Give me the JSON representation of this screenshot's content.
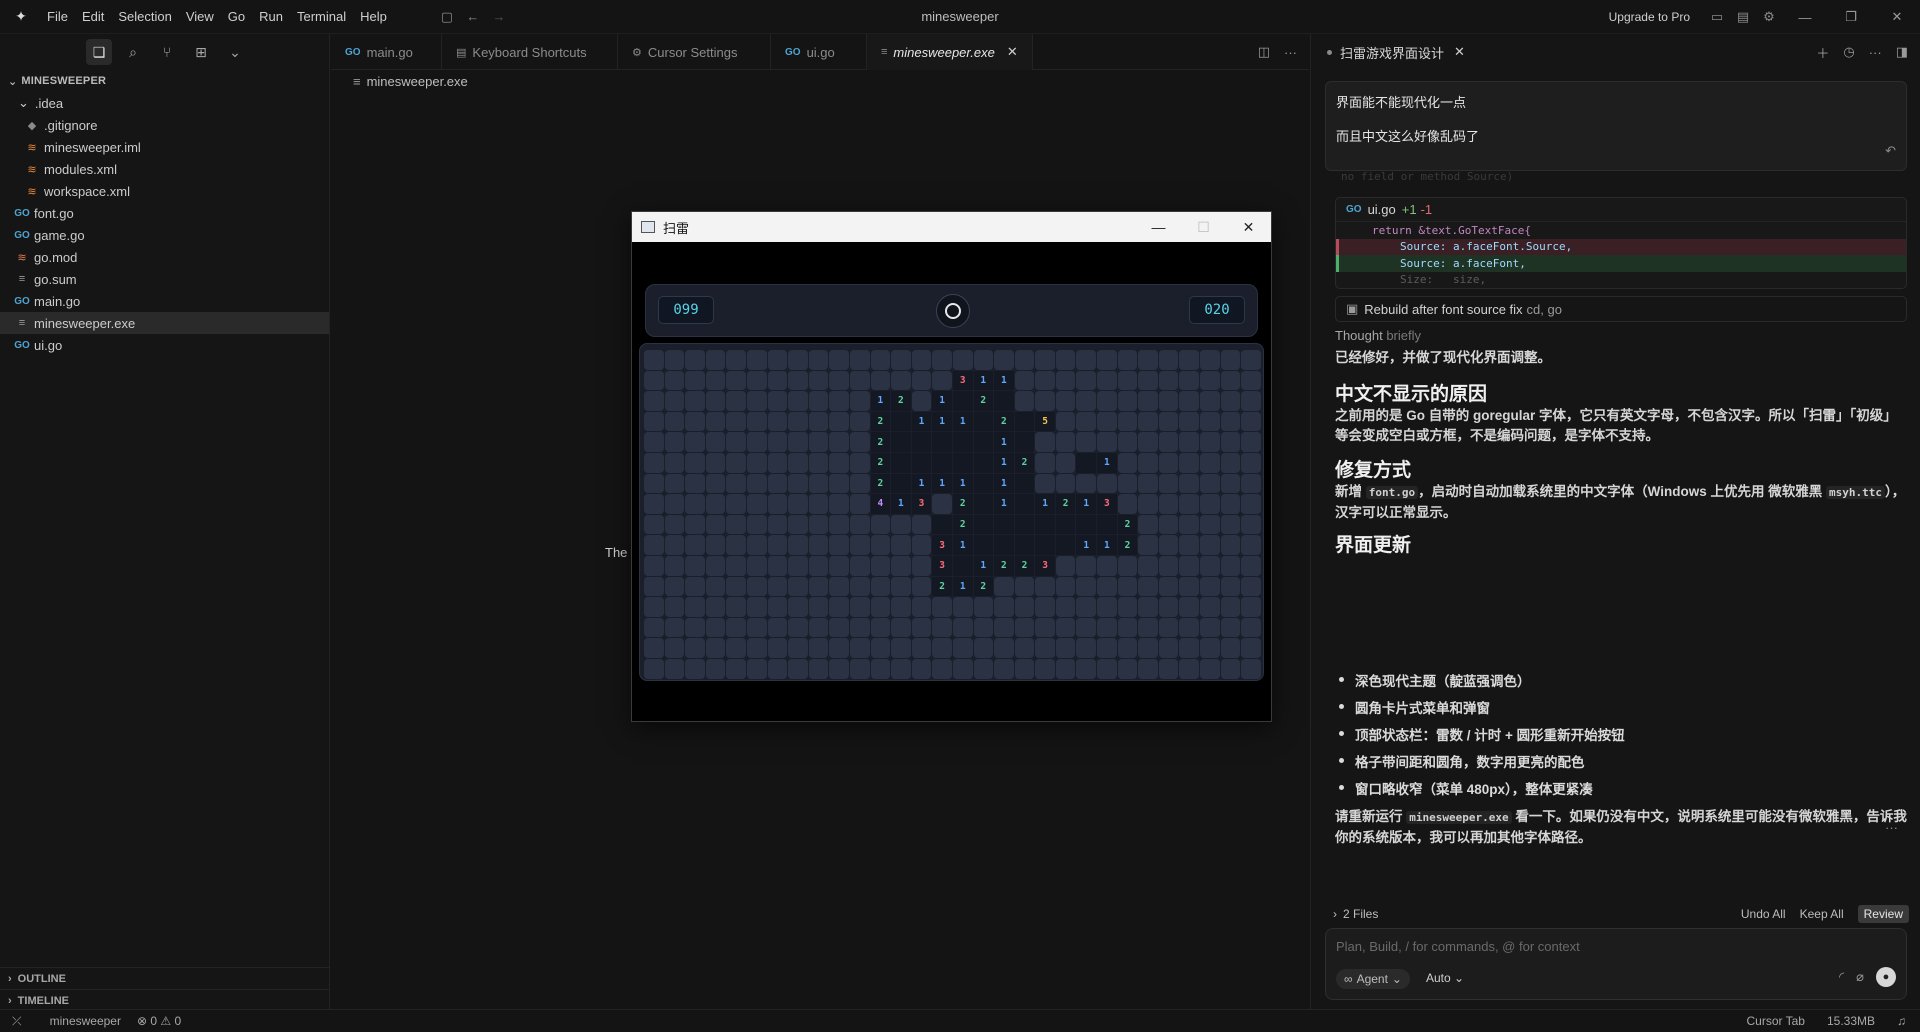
{
  "titlebar": {
    "menu": [
      "File",
      "Edit",
      "Selection",
      "View",
      "Go",
      "Run",
      "Terminal",
      "Help"
    ],
    "app_title": "minesweeper",
    "upgrade_label": "Upgrade to Pro"
  },
  "sidebar": {
    "explorer_title": "MINESWEEPER",
    "folder": ".idea",
    "idea_items": [
      ".gitignore",
      "minesweeper.iml",
      "modules.xml",
      "workspace.xml"
    ],
    "root_items": [
      "font.go",
      "game.go",
      "go.mod",
      "go.sum",
      "main.go",
      "minesweeper.exe",
      "ui.go"
    ],
    "outline": "OUTLINE",
    "timeline": "TIMELINE"
  },
  "editor": {
    "tabs": [
      "main.go",
      "Keyboard Shortcuts",
      "Cursor Settings",
      "ui.go",
      "minesweeper.exe"
    ],
    "breadcrumb": "minesweeper.exe",
    "body_text": "The"
  },
  "game": {
    "window_title": "扫雷",
    "mine_count": "099",
    "timer": "020",
    "rows": [
      "..............................",
      "...............311............",
      "...........12X1.2.............",
      "...........2.111.2.5..........",
      "...........2.....1............",
      "...........2.....12...1.......",
      "...........2.111.1............",
      "...........413X2.1.1213.......",
      "...............2.......2......",
      "..............31.....112......",
      "..............3.1223..........",
      "..............212.............",
      "..............................",
      "..............................",
      "..............................",
      ".............................."
    ]
  },
  "chat": {
    "tab_title": "扫雷游戏界面设计",
    "user_msg_line1": "界面能不能现代化一点",
    "user_msg_line2": "而且中文这么好像乱码了",
    "faded_line": "no field or method Source)",
    "diff_file": "ui.go",
    "diff_plus": "+1",
    "diff_minus": "-1",
    "code_return": "return &text.GoTextFace{",
    "code_del": "Source: a.faceFont.Source,",
    "code_add": "Source: a.faceFont,",
    "code_size": "Size:   size,",
    "cmd_label": "Rebuild after font source fix",
    "cmd_detail": "cd, go",
    "thought_prefix": "Thought",
    "thought_suffix": "briefly",
    "summary": "已经修好，并做了现代化界面调整。",
    "h1": "中文不显示的原因",
    "p1": "之前用的是 Go 自带的 goregular 字体，它只有英文字母，不包含汉字。所以「扫雷」「初级」等会变成空白或方框，不是编码问题，是字体不支持。",
    "h2": "修复方式",
    "p2_a": "新增",
    "p2_code1": "font.go",
    "p2_b": "，启动时自动加载系统里的中文字体（Windows 上优先用 微软雅黑",
    "p2_code2": "msyh.ttc",
    "p2_c": "），汉字可以正常显示。",
    "h3": "界面更新",
    "bullets": [
      "深色现代主题（靛蓝强调色）",
      "圆角卡片式菜单和弹窗",
      "顶部状态栏：雷数 / 计时 + 圆形重新开始按钮",
      "格子带间距和圆角，数字用更亮的配色",
      "窗口略收窄（菜单 480px），整体更紧凑"
    ],
    "p3_a": "请重新运行",
    "p3_code": "minesweeper.exe",
    "p3_b": "看一下。如果仍没有中文，说明系统里可能没有微软雅黑，告诉我你的系统版本，我可以再加其他字体路径。",
    "files_label": "2 Files",
    "undo_all": "Undo All",
    "keep_all": "Keep All",
    "review": "Review",
    "input_placeholder": "Plan, Build, / for commands, @ for context",
    "agent_label": "Agent",
    "auto_label": "Auto"
  },
  "statusbar": {
    "branch": "minesweeper",
    "errors": "0",
    "warnings": "0",
    "cursor_tab": "Cursor Tab",
    "memory": "15.33MB"
  },
  "colors": {
    "accent": "#58d3e6",
    "board_bg": "#1a1f2b",
    "cell_closed": "#2a3244"
  }
}
